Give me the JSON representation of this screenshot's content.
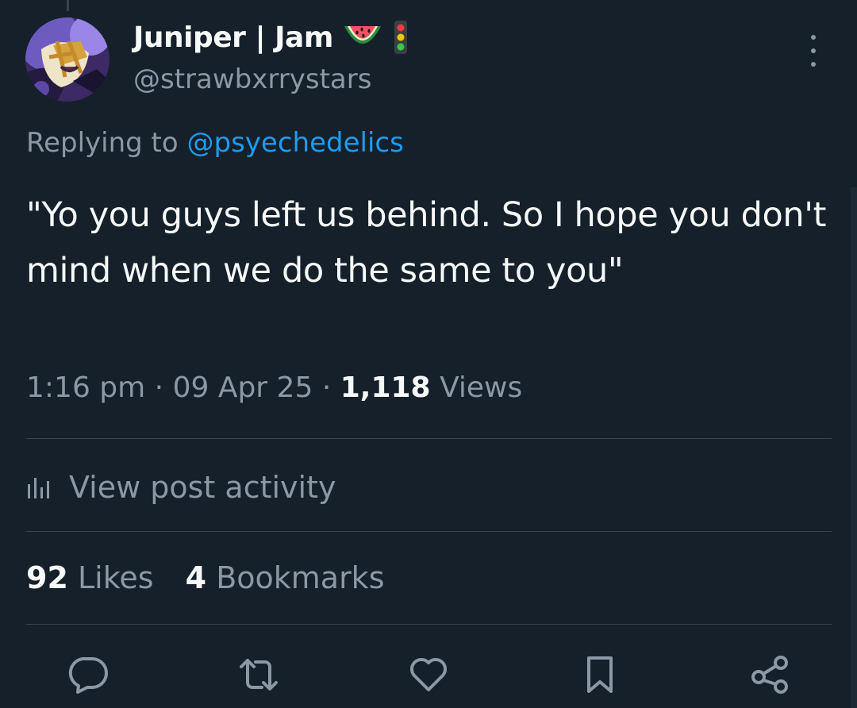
{
  "author": {
    "display_name": "Juniper | Jam",
    "emojis": [
      "watermelon-emoji",
      "traffic-light-emoji"
    ],
    "handle": "@strawbxrrystars"
  },
  "reply": {
    "prefix": "Replying to",
    "mention": "@psyechedelics"
  },
  "tweet": {
    "text": "\"Yo you guys left us behind. So I hope you don't mind when we do the same to you\""
  },
  "meta": {
    "time": "1:16 pm",
    "date": "09 Apr 25",
    "views_count": "1,118",
    "views_label": "Views"
  },
  "activity": {
    "label": "View post activity",
    "icon": "bar-chart-icon"
  },
  "stats": {
    "likes_count": "92",
    "likes_label": "Likes",
    "bookmarks_count": "4",
    "bookmarks_label": "Bookmarks"
  },
  "actions": [
    "reply-icon",
    "retweet-icon",
    "like-icon",
    "bookmark-icon",
    "share-icon"
  ],
  "colors": {
    "background": "#15202b",
    "text": "#f7f9f9",
    "secondary": "#8b98a5",
    "accent": "#1d9bf0",
    "divider": "#38444d"
  }
}
